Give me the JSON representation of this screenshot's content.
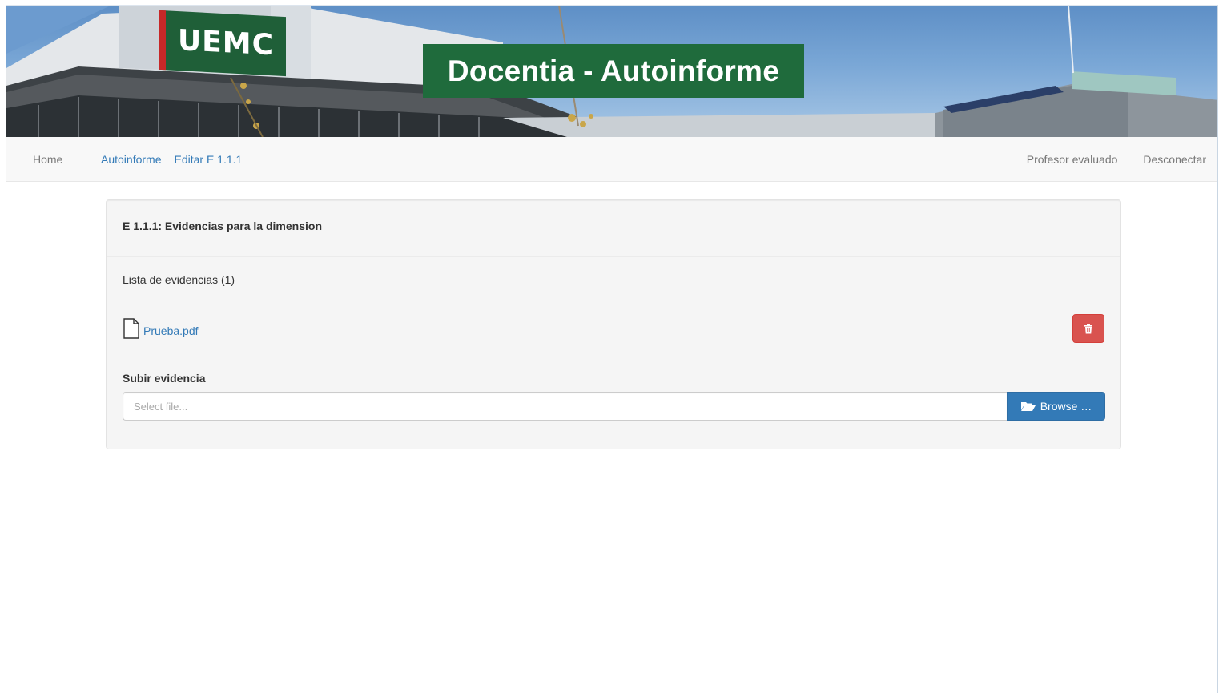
{
  "header": {
    "logo_text": "UEMC",
    "banner_title": "Docentia - Autoinforme"
  },
  "navbar": {
    "home": "Home",
    "breadcrumb": [
      "Autoinforme",
      "Editar E 1.1.1"
    ],
    "right": [
      "Profesor evaluado",
      "Desconectar"
    ]
  },
  "panel": {
    "title": "E 1.1.1: Evidencias para la dimension",
    "list_heading": "Lista de evidencias (1)",
    "files": [
      {
        "name": "Prueba.pdf",
        "icon": "file-icon"
      }
    ],
    "delete_icon": "trash-icon",
    "upload_label": "Subir evidencia",
    "file_input_placeholder": "Select file...",
    "browse_label": "Browse …",
    "browse_icon": "folder-open-icon"
  },
  "colors": {
    "banner_green": "#1f6b3c",
    "link_blue": "#337ab7",
    "danger_red": "#d9534f",
    "primary_blue": "#337ab7"
  }
}
